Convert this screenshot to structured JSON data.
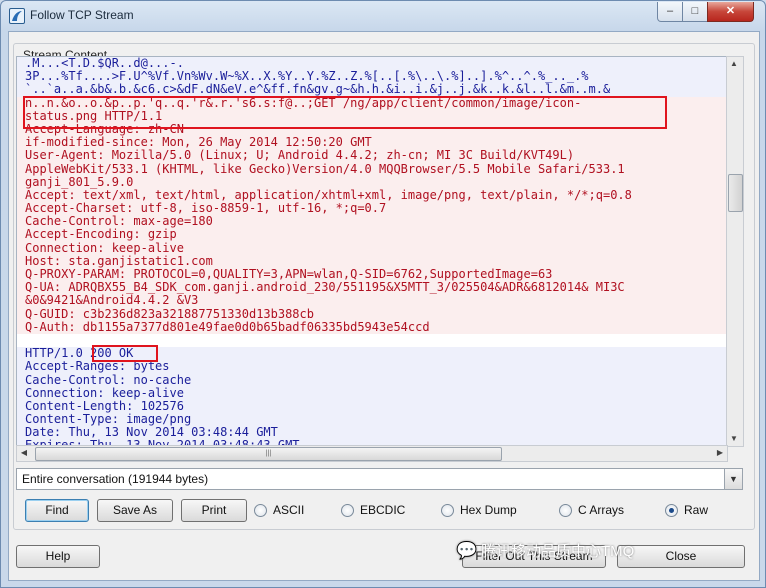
{
  "window": {
    "title": "Follow TCP Stream",
    "minimize": "–",
    "maximize": "□",
    "close": "✕"
  },
  "group_label": "Stream Content",
  "stream": {
    "lines": [
      {
        "t": ".M...<T.D.$QR..d@...-.",
        "k": "s"
      },
      {
        "t": "3P...%Tf....>F.U^%Vf.Vn%Wv.W~%X..X.%Y..Y.%Z..Z.%[..[.%\\..\\.%]..].%^..^.%_.._.%",
        "k": "s"
      },
      {
        "t": "`..`a..a.&b&.b.&c6.c>&dF.dN&eV.e^&ff.fn&gv.g~&h.h.&i..i.&j..j.&k..k.&l..l.&m..m.&",
        "k": "s"
      },
      {
        "t": "n..n.&o..o.&p..p.'q..q.'r&.r.'s6.s:f@..;GET /ng/app/client/common/image/icon-",
        "k": "c"
      },
      {
        "t": "status.png HTTP/1.1",
        "k": "c"
      },
      {
        "t": "Accept-Language: zh-CN",
        "k": "c"
      },
      {
        "t": "if-modified-since: Mon, 26 May 2014 12:50:20 GMT",
        "k": "c"
      },
      {
        "t": "User-Agent: Mozilla/5.0 (Linux; U; Android 4.4.2; zh-cn; MI 3C Build/KVT49L)",
        "k": "c"
      },
      {
        "t": "AppleWebKit/533.1 (KHTML, like Gecko)Version/4.0 MQQBrowser/5.5 Mobile Safari/533.1",
        "k": "c"
      },
      {
        "t": "ganji_801_5.9.0",
        "k": "c"
      },
      {
        "t": "Accept: text/xml, text/html, application/xhtml+xml, image/png, text/plain, */*;q=0.8",
        "k": "c"
      },
      {
        "t": "Accept-Charset: utf-8, iso-8859-1, utf-16, *;q=0.7",
        "k": "c"
      },
      {
        "t": "Cache-Control: max-age=180",
        "k": "c"
      },
      {
        "t": "Accept-Encoding: gzip",
        "k": "c"
      },
      {
        "t": "Connection: keep-alive",
        "k": "c"
      },
      {
        "t": "Host: sta.ganjistatic1.com",
        "k": "c"
      },
      {
        "t": "Q-PROXY-PARAM: PROTOCOL=0,QUALITY=3,APN=wlan,Q-SID=6762,SupportedImage=63",
        "k": "c"
      },
      {
        "t": "Q-UA: ADRQBX55_B4_SDK_com.ganji.android_230/551195&X5MTT_3/025504&ADR&6812014& MI3C",
        "k": "c"
      },
      {
        "t": "&0&9421&Android4.4.2 &V3",
        "k": "c"
      },
      {
        "t": "Q-GUID: c3b236d823a321887751330d13b388cb",
        "k": "c"
      },
      {
        "t": "Q-Auth: db1155a7377d801e49fae0d0b65badf06335bd5943e54ccd",
        "k": "c"
      },
      {
        "t": "",
        "k": "blank"
      },
      {
        "t": "HTTP/1.0 200 OK",
        "k": "s"
      },
      {
        "t": "Accept-Ranges: bytes",
        "k": "s"
      },
      {
        "t": "Cache-Control: no-cache",
        "k": "s"
      },
      {
        "t": "Connection: keep-alive",
        "k": "s"
      },
      {
        "t": "Content-Length: 102576",
        "k": "s"
      },
      {
        "t": "Content-Type: image/png",
        "k": "s"
      },
      {
        "t": "Date: Thu, 13 Nov 2014 03:48:44 GMT",
        "k": "s"
      },
      {
        "t": "Expires: Thu, 13 Nov 2014 03:48:43 GMT",
        "k": "s"
      }
    ]
  },
  "conversation_select": {
    "value": "Entire conversation (191944 bytes)"
  },
  "buttons": {
    "find": "Find",
    "save_as": "Save As",
    "print": "Print",
    "help": "Help",
    "filter_out": "Filter Out This Stream",
    "close": "Close"
  },
  "formats": [
    {
      "label": "ASCII",
      "selected": false
    },
    {
      "label": "EBCDIC",
      "selected": false
    },
    {
      "label": "Hex Dump",
      "selected": false
    },
    {
      "label": "C Arrays",
      "selected": false
    },
    {
      "label": "Raw",
      "selected": true
    }
  ],
  "watermark": "腾讯移动品质中心TMQ"
}
